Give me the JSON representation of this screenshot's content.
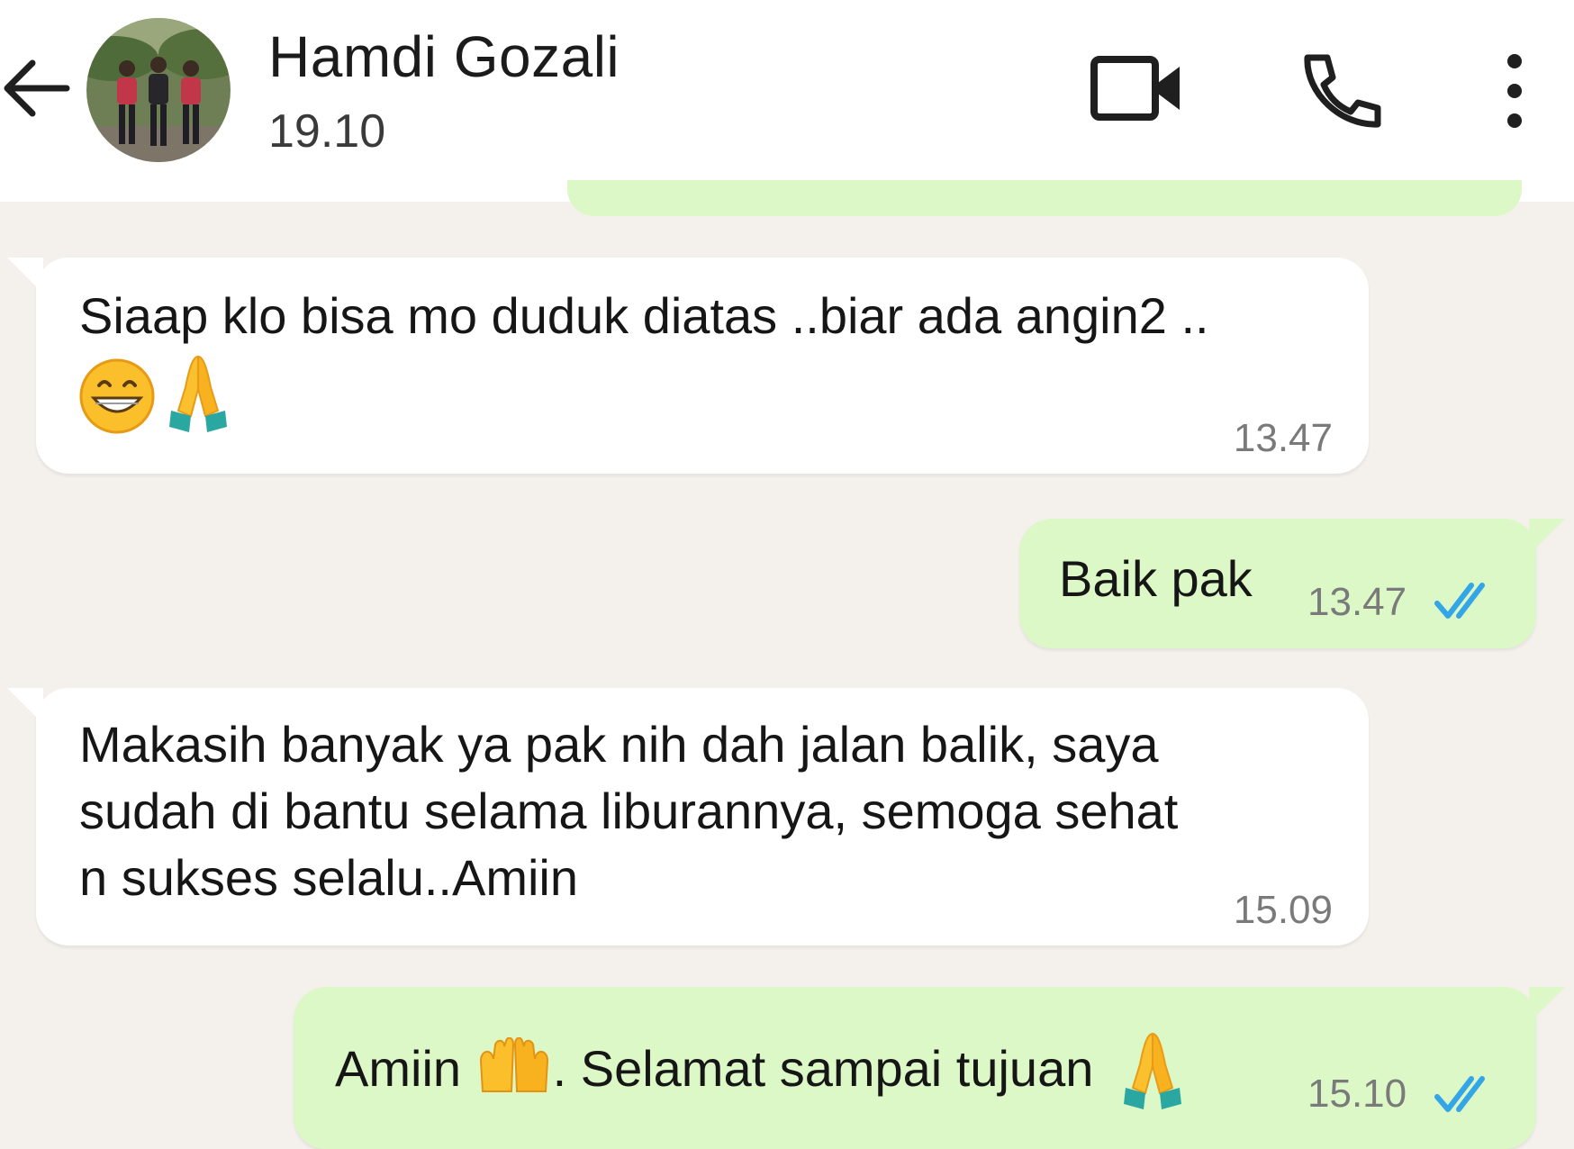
{
  "header": {
    "contact_name": "Hamdi Gozali",
    "status": "19.10",
    "back_icon": "arrow-left-icon",
    "video_icon": "video-camera-icon",
    "call_icon": "phone-icon",
    "menu_icon": "more-vertical-icon"
  },
  "colors": {
    "header_bg": "#ffffff",
    "chat_bg": "#f4f1ec",
    "incoming_bubble": "#ffffff",
    "outgoing_bubble": "#dcf8c6",
    "read_ticks": "#34a6e8",
    "timestamp": "#7a7a7a"
  },
  "messages": [
    {
      "direction": "incoming",
      "text": "Siaap klo bisa mo duduk diatas ..biar ada angin2 ..",
      "emojis": [
        "grinning-face-emoji",
        "folded-hands-emoji"
      ],
      "time": "13.47"
    },
    {
      "direction": "outgoing",
      "text": "Baik pak",
      "time": "13.47",
      "status": "read"
    },
    {
      "direction": "incoming",
      "text": "Makasih banyak ya pak nih dah jalan balik, saya\nsudah di bantu selama liburannya, semoga sehat\nn sukses selalu..Amiin",
      "time": "15.09"
    },
    {
      "direction": "outgoing",
      "text_before": "Amiin",
      "text_middle": ". Selamat sampai tujuan",
      "emojis": [
        "raised-hands-emoji",
        "folded-hands-emoji"
      ],
      "time": "15.10",
      "status": "read"
    }
  ]
}
